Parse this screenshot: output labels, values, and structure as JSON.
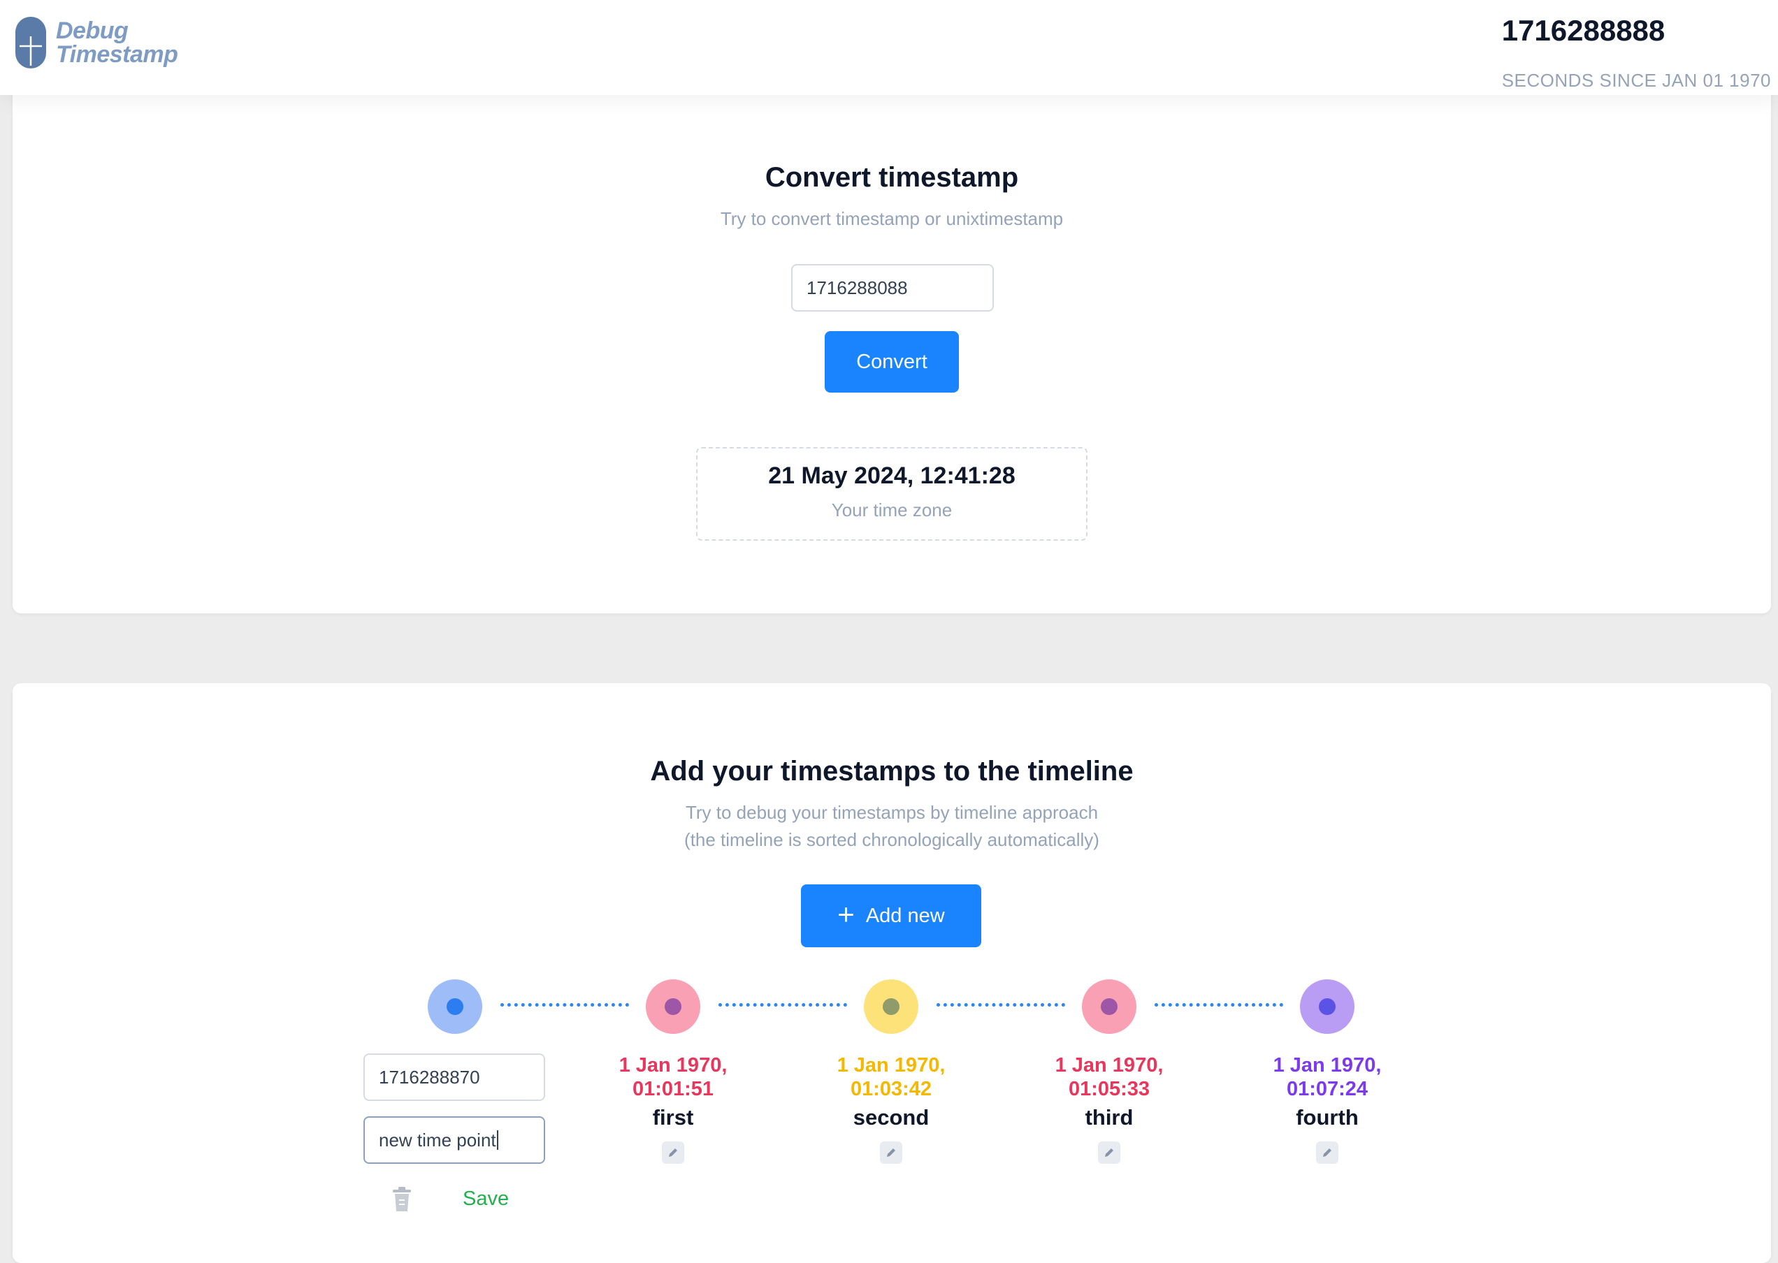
{
  "header": {
    "logo_line1": "Debug",
    "logo_line2": "Timestamp",
    "current_timestamp": "1716288888",
    "current_caption": "SECONDS SINCE JAN 01 1970"
  },
  "converter": {
    "title": "Convert timestamp",
    "subtitle": "Try to convert timestamp or unixtimestamp",
    "input_value": "1716288088",
    "button_label": "Convert",
    "result_date": "21 May 2024, 12:41:28",
    "result_zone": "Your time zone"
  },
  "timeline": {
    "title": "Add your timestamps to the timeline",
    "subtitle_line1": "Try to debug your timestamps by timeline approach",
    "subtitle_line2": "(the timeline is sorted chronologically automatically)",
    "add_button_label": "Add new",
    "new_point": {
      "timestamp_value": "1716288870",
      "name_value": "new time point",
      "save_label": "Save",
      "outer_color": "#9dbcf8",
      "dot_color": "#2b7df0"
    },
    "points": [
      {
        "date_line1": "1 Jan 1970,",
        "date_line2": "01:01:51",
        "name": "first",
        "text_color": "#e8365d",
        "outer_color": "#f9a0b5",
        "dot_color": "#9e56a6"
      },
      {
        "date_line1": "1 Jan 1970,",
        "date_line2": "01:03:42",
        "name": "second",
        "text_color": "#f5b800",
        "outer_color": "#fde27a",
        "dot_color": "#8f9b6a"
      },
      {
        "date_line1": "1 Jan 1970,",
        "date_line2": "01:05:33",
        "name": "third",
        "text_color": "#e8365d",
        "outer_color": "#f9a0b5",
        "dot_color": "#9e56a6"
      },
      {
        "date_line1": "1 Jan 1970,",
        "date_line2": "01:07:24",
        "name": "fourth",
        "text_color": "#7c3aed",
        "outer_color": "#b99cf3",
        "dot_color": "#5b52e6"
      }
    ]
  },
  "colors": {
    "accent": "#1a84ff",
    "timeline_connector": "#2b86f4",
    "save": "#22b14c"
  },
  "icons": [
    "logo-mark-icon",
    "plus-icon",
    "edit-pencil-icon",
    "trash-icon"
  ]
}
